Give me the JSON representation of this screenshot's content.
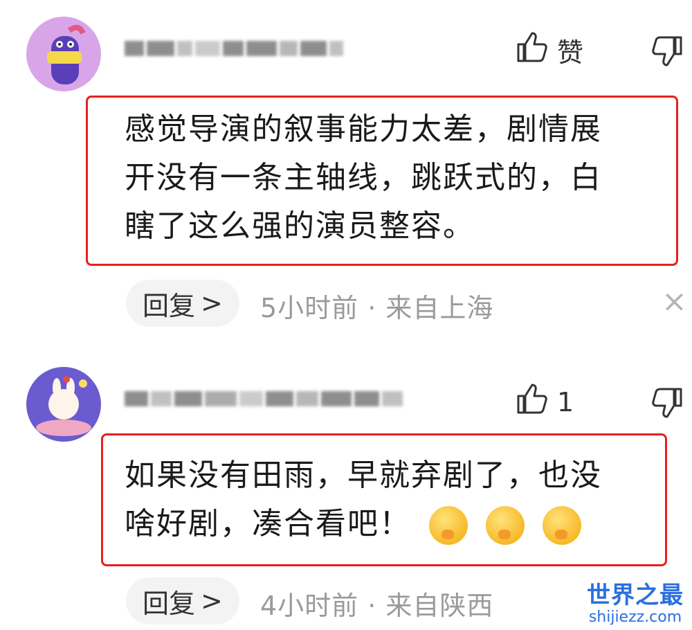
{
  "comments": [
    {
      "like_label": "赞",
      "text_lines": [
        "感觉导演的叙事能力太差，剧情展",
        "开没有一条主轴线，跳跃式的，白",
        "瞎了这么强的演员整容。"
      ],
      "reply_label": "回复",
      "reply_chevron": ">",
      "meta": "5小时前 · 来自上海",
      "close": "×"
    },
    {
      "like_label": "1",
      "text_lines": [
        "如果没有田雨，早就弃剧了，也没",
        "啥好剧，凑合看吧！"
      ],
      "reply_label": "回复",
      "reply_chevron": ">",
      "meta": "4小时前 · 来自陕西",
      "emoji_icons": [
        "face-emoji-icon",
        "face-emoji-icon",
        "face-emoji-icon"
      ]
    }
  ],
  "watermark": {
    "main": "世界之最",
    "sub": "shijiezz.com"
  },
  "colors": {
    "highlight_border": "#e6201e",
    "meta_text": "#9a9a9a",
    "watermark": "#2a6fe0"
  }
}
